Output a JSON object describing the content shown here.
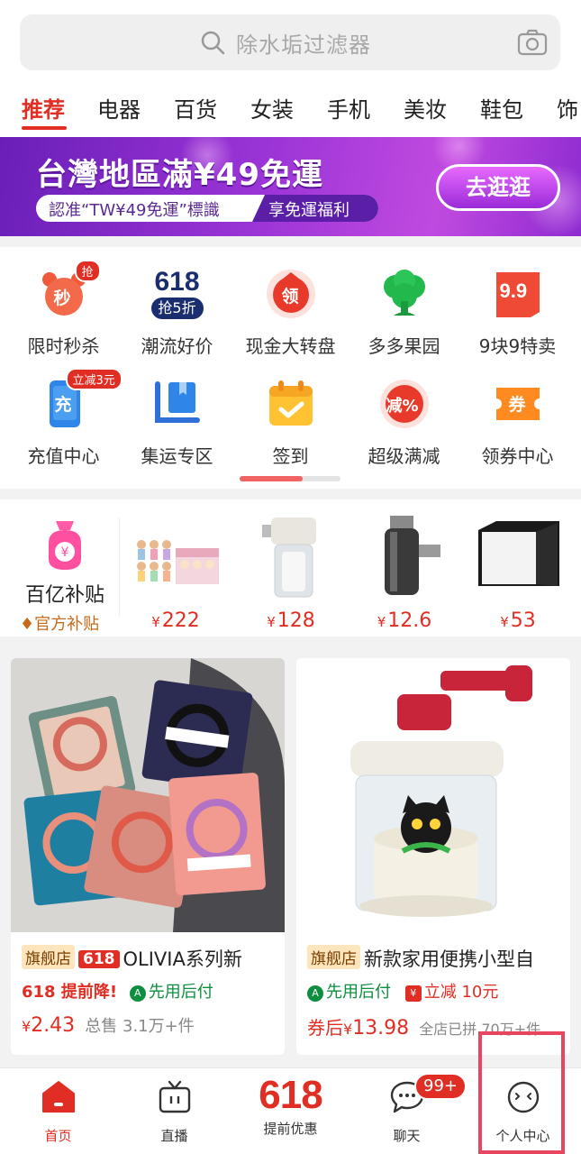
{
  "search": {
    "placeholder": "除水垢过滤器"
  },
  "tabs": [
    "推荐",
    "电器",
    "百货",
    "女装",
    "手机",
    "美妆",
    "鞋包",
    "饰"
  ],
  "banner": {
    "title": "台灣地區滿¥49免運",
    "pill_left": "認准“TW¥49免運”標識",
    "pill_right": "享免運福利",
    "button": "去逛逛"
  },
  "grid": [
    {
      "label": "限时秒杀",
      "icon": "alarm-clock-icon",
      "icon_text": "秒",
      "badge": "抢"
    },
    {
      "label": "潮流好价",
      "icon": "618-discount-icon",
      "icon_text": "618",
      "icon_sub": "抢5折"
    },
    {
      "label": "现金大转盘",
      "icon": "red-envelope-icon",
      "icon_text": "领"
    },
    {
      "label": "多多果园",
      "icon": "tree-icon"
    },
    {
      "label": "9块9特卖",
      "icon": "tag-9-9-icon",
      "icon_text": "9.9"
    },
    {
      "label": "充值中心",
      "icon": "phone-recharge-icon",
      "icon_text": "充",
      "badge": "立减3元"
    },
    {
      "label": "集运专区",
      "icon": "shipping-icon"
    },
    {
      "label": "签到",
      "icon": "calendar-check-icon"
    },
    {
      "label": "超级满减",
      "icon": "discount-icon",
      "icon_text": "减%"
    },
    {
      "label": "领券中心",
      "icon": "coupon-icon",
      "icon_text": "券"
    }
  ],
  "subsidy": {
    "title": "百亿补贴",
    "subtitle": "官方补贴",
    "items": [
      {
        "price": "222",
        "icon": "figurine-set-icon"
      },
      {
        "price": "128",
        "icon": "water-filter-icon"
      },
      {
        "price": "12.6",
        "icon": "faucet-filter-icon"
      },
      {
        "price": "53",
        "icon": "photo-lightbox-icon"
      }
    ]
  },
  "products": [
    {
      "tag": "旗舰店",
      "tag2": "618",
      "title": "OLIVIA系列新",
      "promo1": "618 提前降!",
      "promo2": "先用后付",
      "price": "2.43",
      "sold": "总售 3.1万+件"
    },
    {
      "tag": "旗舰店",
      "title": "新款家用便携小型自",
      "promo1": "先用后付",
      "promo2": "立减 10元",
      "price_prefix": "券后",
      "price": "13.98",
      "sold": "全店已拼 70万+件"
    }
  ],
  "tabbar": [
    {
      "label": "首页",
      "icon": "home-icon",
      "active": true
    },
    {
      "label": "直播",
      "icon": "tv-icon"
    },
    {
      "label": "提前优惠",
      "big": "618"
    },
    {
      "label": "聊天",
      "icon": "chat-bubble-icon",
      "badge": "99+"
    },
    {
      "label": "个人中心",
      "icon": "profile-face-icon"
    }
  ],
  "colors": {
    "accent": "#e02e24",
    "highlight": "#e8455f"
  }
}
